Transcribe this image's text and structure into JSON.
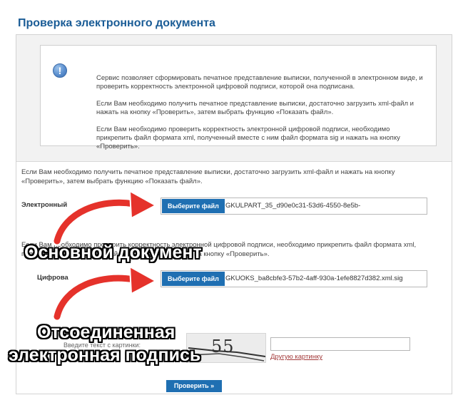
{
  "page": {
    "title": "Проверка электронного документа"
  },
  "info": {
    "icon": "exclamation-info-icon",
    "p1": "Сервис позволяет сформировать печатное представление выписки, полученной в электронном виде, и проверить корректность электронной цифровой подписи, которой она подписана.",
    "p2": "Если Вам необходимо получить печатное представление выписки, достаточно загрузить xml-файл и нажать на кнопку «Проверить», затем выбрать функцию «Показать файл».",
    "p3": "Если Вам необходимо проверить корректность электронной цифровой подписи, необходимо прикрепить файл формата xml, полученный вместе с ним файл формата sig и нажать на кнопку «Проверить»."
  },
  "doc_section": {
    "text": "Если Вам необходимо получить печатное представление выписки, достаточно загрузить xml-файл и нажать на кнопку «Проверить», затем выбрать функцию «Показать файл».",
    "label": "Электронный",
    "button": "Выберите файл",
    "file_name": "GKULPART_35_d90e0c31-53d6-4550-8e5b-"
  },
  "sig_section": {
    "text": "Если Вам необходимо проверить корректность электронной цифровой подписи, необходимо прикрепить файл формата xml, полученный вместе с ним файл формата sig и нажать на кнопку «Проверить».",
    "label": "Цифрова",
    "button": "Выберите файл",
    "file_name": "GKUOKS_ba8cbfe3-57b2-4aff-930a-1efe8827d382.xml.sig"
  },
  "captcha": {
    "label": "Введите текст с картинки:",
    "image_text": "55",
    "input_value": "",
    "link": "Другую картинку"
  },
  "submit": {
    "label": "Проверить »"
  },
  "annotations": {
    "main_doc": "Основной документ",
    "detached_sig_line1": "Отсоединенная",
    "detached_sig_line2": "электронная подпись",
    "arrow_color": "#e5322b"
  },
  "colors": {
    "accent": "#1f6fb2",
    "title": "#1a5c96",
    "link": "#a33a3a"
  }
}
